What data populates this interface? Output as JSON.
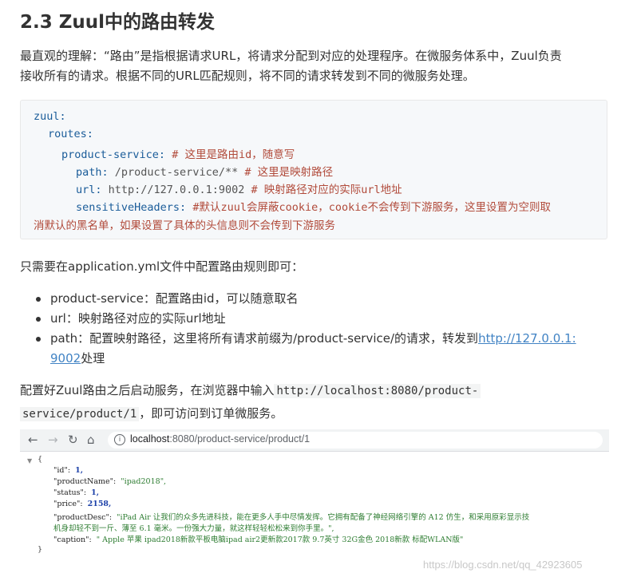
{
  "heading": "2.3 Zuul中的路由转发",
  "intro_line1": "最直观的理解：“路由”是指根据请求URL，将请求分配到对应的处理程序。在微服务体系中，Zuul负责",
  "intro_line2": "接收所有的请求。根据不同的URL匹配规则，将不同的请求转发到不同的微服务处理。",
  "code": {
    "zuul_key": "zuul:",
    "routes_key": "routes:",
    "service_key": "product-service:",
    "service_comment": "# 这里是路由id，随意写",
    "path_key": "path:",
    "path_val": "/product-service/**",
    "path_comment": "# 这里是映射路径",
    "url_key": "url:",
    "url_val": "http://127.0.0.1:9002",
    "url_comment": "# 映射路径对应的实际url地址",
    "sensitive_key": "sensitiveHeaders:",
    "sensitive_comment": "#默认zuul会屏蔽cookie，cookie不会传到下游服务，这里设置为空则取",
    "sensitive_comment_cont": "消默认的黑名单，如果设置了具体的头信息则不会传到下游服务"
  },
  "para2": "只需要在application.yml文件中配置路由规则即可：",
  "bullets": {
    "b1": "product-service：配置路由id，可以随意取名",
    "b2": "url：映射路径对应的实际url地址",
    "b3_pre": "path：配置映射路径，这里将所有请求前缀为/product-service/的请求，转发到",
    "b3_link1": "http://127.0.0.1:",
    "b3_link2": "9002",
    "b3_post": "处理"
  },
  "para3": {
    "pre": "配置好Zuul路由之后启动服务，在浏览器中输入",
    "code1": "http://localhost:8080/product-",
    "code2": "service/product/1",
    "post": "，即可访问到订单微服务。"
  },
  "browser": {
    "back_icon": "back-arrow-icon",
    "forward_icon": "forward-arrow-icon",
    "reload_icon": "reload-icon",
    "home_icon": "home-icon",
    "url_host": "localhost",
    "url_rest": ":8080/product-service/product/1"
  },
  "json": {
    "open": "{",
    "close": "}",
    "id_key": "\"id\":",
    "id_val": "1,",
    "name_key": "\"productName\":",
    "name_val": "\"ipad2018\",",
    "status_key": "\"status\":",
    "status_val": "1,",
    "price_key": "\"price\":",
    "price_val": "2158,",
    "desc_key": "\"productDesc\":",
    "desc_val1": "\"iPad Air 让我们的众多先进科技，能在更多人手中尽情发挥。它拥有配备了神经网络引擎的 A12 仿生，和采用原彩显示技",
    "desc_val2": "机身却轻不到一斤、薄至 6.1 毫米。一份强大力量，就这样轻轻松松来到你手里。\",",
    "caption_key": "\"caption\":",
    "caption_val": "\" Apple 苹果 ipad2018新款平板电脑ipad air2更新款2017款 9.7英寸 32G金色 2018新款 标配WLAN版\""
  },
  "watermark": "https://blog.csdn.net/qq_42923605"
}
